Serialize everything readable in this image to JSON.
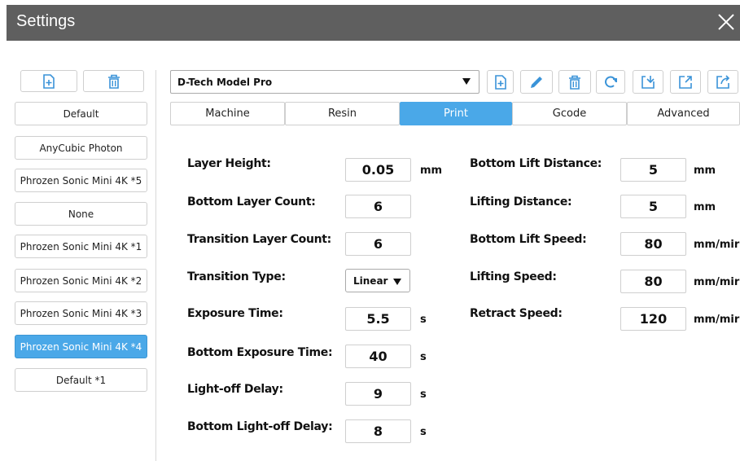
{
  "window": {
    "title": "Settings"
  },
  "sidebar": {
    "profiles": [
      {
        "label": "Default",
        "active": false
      },
      {
        "label": "AnyCubic Photon",
        "active": false
      },
      {
        "label": "Phrozen Sonic Mini 4K *5",
        "active": false
      },
      {
        "label": "None",
        "active": false
      },
      {
        "label": "Phrozen Sonic Mini 4K *1",
        "active": false
      },
      {
        "label": "Phrozen Sonic Mini 4K *2",
        "active": false
      },
      {
        "label": "Phrozen Sonic Mini 4K *3",
        "active": false
      },
      {
        "label": "Phrozen Sonic Mini 4K *4",
        "active": true
      },
      {
        "label": "Default *1",
        "active": false
      }
    ]
  },
  "toolbar": {
    "model_select_value": "D-Tech Model Pro"
  },
  "tabs": [
    {
      "label": "Machine",
      "active": false
    },
    {
      "label": "Resin",
      "active": false
    },
    {
      "label": "Print",
      "active": true
    },
    {
      "label": "Gcode",
      "active": false
    },
    {
      "label": "Advanced",
      "active": false
    }
  ],
  "print": {
    "left": [
      {
        "label": "Layer Height:",
        "value": "0.05",
        "unit": "mm"
      },
      {
        "label": "Bottom Layer Count:",
        "value": "6",
        "unit": ""
      },
      {
        "label": "Transition Layer Count:",
        "value": "6",
        "unit": ""
      },
      {
        "label": "Transition Type:",
        "value": "Linear",
        "unit": ""
      },
      {
        "label": "Exposure Time:",
        "value": "5.5",
        "unit": "s"
      },
      {
        "label": "Bottom Exposure Time:",
        "value": "40",
        "unit": "s"
      },
      {
        "label": "Light-off Delay:",
        "value": "9",
        "unit": "s"
      },
      {
        "label": "Bottom Light-off Delay:",
        "value": "8",
        "unit": "s"
      }
    ],
    "right": [
      {
        "label": "Bottom Lift Distance:",
        "value": "5",
        "unit": "mm"
      },
      {
        "label": "Lifting Distance:",
        "value": "5",
        "unit": "mm"
      },
      {
        "label": "Bottom Lift Speed:",
        "value": "80",
        "unit": "mm/mir"
      },
      {
        "label": "Lifting Speed:",
        "value": "80",
        "unit": "mm/mir"
      },
      {
        "label": "Retract Speed:",
        "value": "120",
        "unit": "mm/mir"
      }
    ]
  },
  "colors": {
    "titlebar": "#5f5f5f",
    "accent": "#4aa8e8",
    "icon": "#3a93d8"
  }
}
